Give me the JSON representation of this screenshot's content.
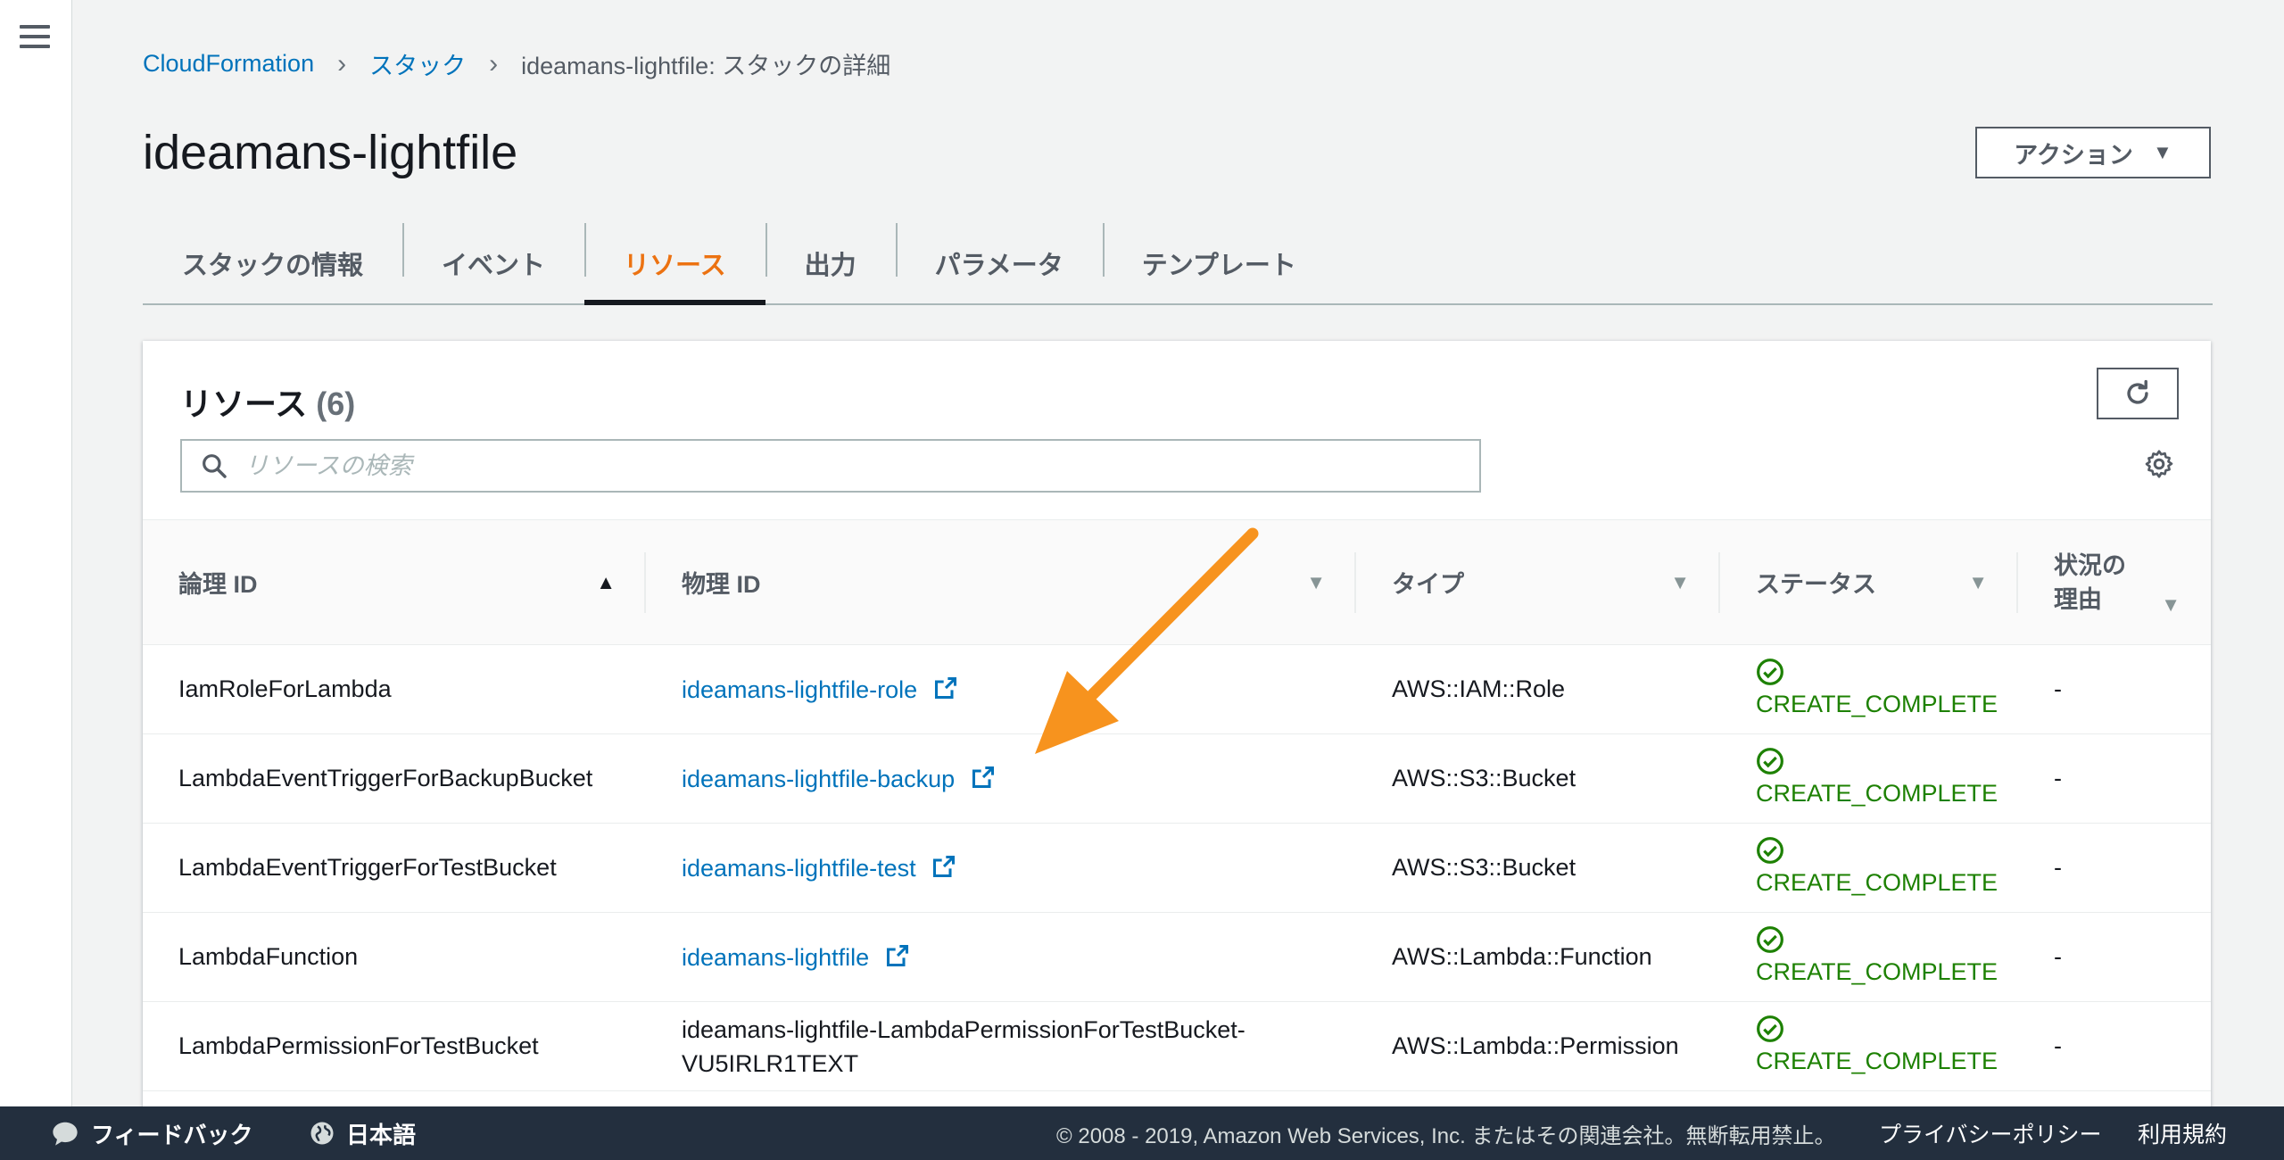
{
  "breadcrumb": {
    "root": "CloudFormation",
    "stacks": "スタック",
    "current": "ideamans-lightfile: スタックの詳細"
  },
  "page": {
    "title": "ideamans-lightfile",
    "action_label": "アクション"
  },
  "tabs": [
    {
      "label": "スタックの情報",
      "active": false
    },
    {
      "label": "イベント",
      "active": false
    },
    {
      "label": "リソース",
      "active": true
    },
    {
      "label": "出力",
      "active": false
    },
    {
      "label": "パラメータ",
      "active": false
    },
    {
      "label": "テンプレート",
      "active": false
    }
  ],
  "resources": {
    "title": "リソース",
    "count": "(6)",
    "search_placeholder": "リソースの検索",
    "columns": {
      "logical_id": "論理 ID",
      "physical_id": "物理 ID",
      "type": "タイプ",
      "status": "ステータス",
      "reason_line1": "状況の",
      "reason_line2": "理由"
    },
    "rows": [
      {
        "logical_id": "IamRoleForLambda",
        "physical_id": "ideamans-lightfile-role",
        "physical_link": true,
        "type": "AWS::IAM::Role",
        "status": "CREATE_COMPLETE",
        "reason": "-"
      },
      {
        "logical_id": "LambdaEventTriggerForBackupBucket",
        "physical_id": "ideamans-lightfile-backup",
        "physical_link": true,
        "type": "AWS::S3::Bucket",
        "status": "CREATE_COMPLETE",
        "reason": "-"
      },
      {
        "logical_id": "LambdaEventTriggerForTestBucket",
        "physical_id": "ideamans-lightfile-test",
        "physical_link": true,
        "type": "AWS::S3::Bucket",
        "status": "CREATE_COMPLETE",
        "reason": "-"
      },
      {
        "logical_id": "LambdaFunction",
        "physical_id": "ideamans-lightfile",
        "physical_link": true,
        "type": "AWS::Lambda::Function",
        "status": "CREATE_COMPLETE",
        "reason": "-"
      },
      {
        "logical_id": "LambdaPermissionForTestBucket",
        "physical_id_line1": "ideamans-lightfile-LambdaPermissionForTestBucket-",
        "physical_id_line2": "VU5IRLR1TEXT",
        "physical_link": false,
        "type": "AWS::Lambda::Permission",
        "status": "CREATE_COMPLETE",
        "reason": "-"
      }
    ]
  },
  "footer": {
    "feedback": "フィードバック",
    "language": "日本語",
    "copyright": "© 2008 - 2019, Amazon Web Services, Inc. またはその関連会社。無断転用禁止。",
    "privacy": "プライバシーポリシー",
    "terms": "利用規約"
  },
  "colors": {
    "accent": "#ec7211",
    "link": "#0073bb",
    "success": "#1d8102",
    "footer_bg": "#232f3e",
    "annotation_arrow": "#f7931e"
  }
}
